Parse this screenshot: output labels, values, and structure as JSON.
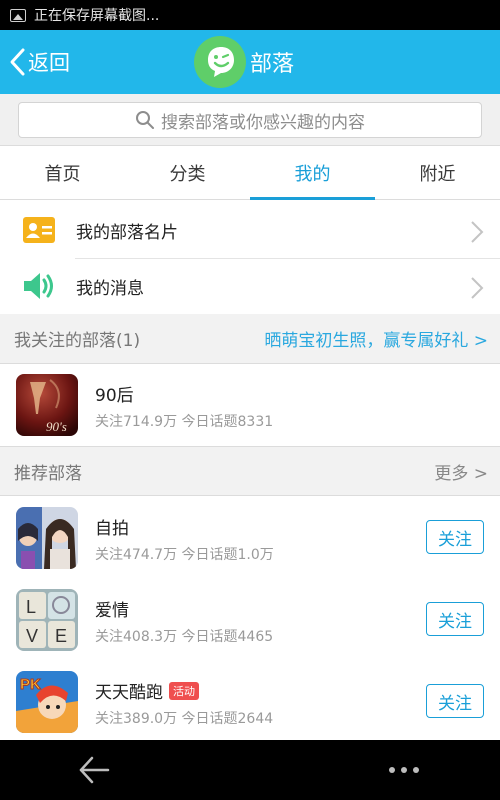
{
  "status_bar": {
    "text": "正在保存屏幕截图..."
  },
  "header": {
    "back_label": "返回",
    "title": "部落"
  },
  "search": {
    "placeholder": "搜索部落或你感兴趣的内容"
  },
  "tabs": [
    {
      "label": "首页",
      "active": false
    },
    {
      "label": "分类",
      "active": false
    },
    {
      "label": "我的",
      "active": true
    },
    {
      "label": "附近",
      "active": false
    }
  ],
  "menu": {
    "card_label": "我的部落名片",
    "messages_label": "我的消息"
  },
  "followed": {
    "title": "我关注的部落(1)",
    "promo_link": "晒萌宝初生照，赢专属好礼 >",
    "items": [
      {
        "name": "90后",
        "meta": "关注714.9万 今日话题8331",
        "thumb_text": "90's"
      }
    ]
  },
  "recommended": {
    "title": "推荐部落",
    "more_label": "更多 >",
    "items": [
      {
        "name": "自拍",
        "meta": "关注474.7万 今日话题1.0万",
        "button": "关注"
      },
      {
        "name": "爱情",
        "meta": "关注408.3万 今日话题4465",
        "button": "关注",
        "thumb_letters": [
          "L",
          "O",
          "V",
          "E"
        ]
      },
      {
        "name": "天天酷跑",
        "badge": "活动",
        "meta": "关注389.0万 今日话题2644",
        "button": "关注",
        "thumb_text": "PK"
      }
    ]
  },
  "colors": {
    "accent": "#22b7ea",
    "link": "#1a9fd8",
    "badge": "#ef4f4f",
    "logo": "#5fce69"
  }
}
